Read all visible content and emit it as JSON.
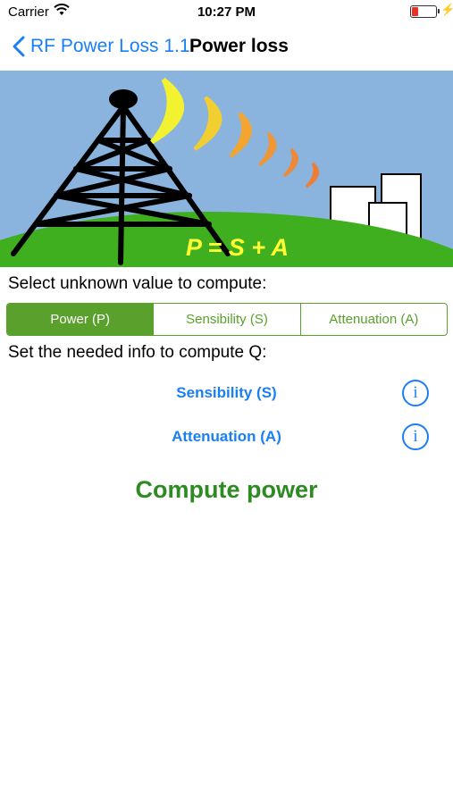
{
  "status_bar": {
    "carrier": "Carrier",
    "time": "10:27 PM",
    "battery_color": "#e5332a"
  },
  "nav": {
    "back_label": "RF Power Loss 1.1",
    "title": "Power loss",
    "accent": "#1a7ff5"
  },
  "banner": {
    "formula": "P = S + A",
    "sky_color": "#8ab3de",
    "ground_color": "#3fae1f"
  },
  "main": {
    "select_label": "Select unknown value to compute:",
    "segments": [
      {
        "label": "Power (P)",
        "selected": true
      },
      {
        "label": "Sensibility (S)",
        "selected": false
      },
      {
        "label": "Attenuation (A)",
        "selected": false
      }
    ],
    "info_label": "Set the needed info to compute Q:",
    "fields": [
      {
        "label": "Sensibility (S)",
        "icon": "info-icon"
      },
      {
        "label": "Attenuation (A)",
        "icon": "info-icon"
      }
    ],
    "compute_label": "Compute power",
    "segment_color": "#5aa02c",
    "compute_color": "#2e8b23"
  }
}
